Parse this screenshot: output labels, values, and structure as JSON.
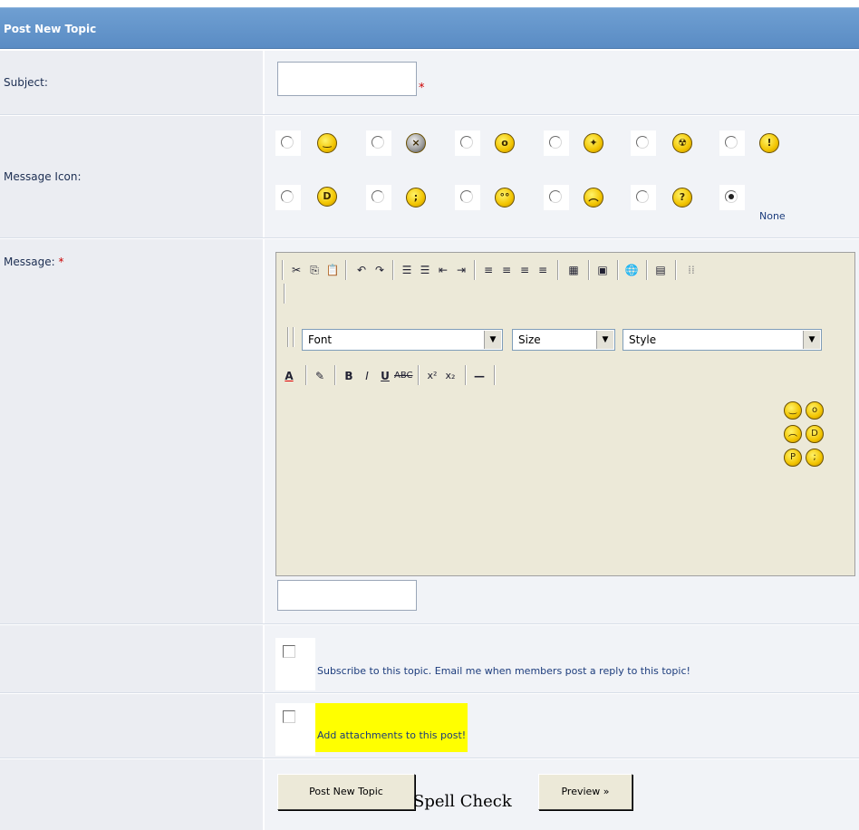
{
  "header": {
    "title": "Post New Topic"
  },
  "subject": {
    "label": "Subject:",
    "value": "",
    "required_mark": "*"
  },
  "message_icon": {
    "label": "Message Icon:",
    "none_label": "None",
    "selected": "None",
    "row1": [
      "smile-icon",
      "angry-icon",
      "shocked-icon",
      "star-icon",
      "radioactive-icon",
      "exclamation-icon"
    ],
    "row2": [
      "big-grin-icon",
      "wink-icon",
      "eyes-icon",
      "sad-icon",
      "question-icon"
    ]
  },
  "message": {
    "label": "Message:",
    "required_mark": "*"
  },
  "editor": {
    "font_select": "Font",
    "size_select": "Size",
    "style_select": "Style",
    "toolbar1": [
      "cut-icon",
      "copy-icon",
      "paste-icon",
      "undo-icon",
      "redo-icon",
      "ordered-list-icon",
      "unordered-list-icon",
      "outdent-icon",
      "indent-icon",
      "align-left-icon",
      "align-center-icon",
      "align-right-icon",
      "table-icon",
      "image-icon",
      "link-icon",
      "form-icon",
      "grid-icon"
    ],
    "toolbar3": [
      "font-color-icon",
      "highlight-icon",
      "bold-icon",
      "italic-icon",
      "underline-icon",
      "strikethrough-icon",
      "superscript-icon",
      "subscript-icon",
      "horizontal-rule-icon"
    ],
    "emoticons": [
      "smile-icon",
      "surprised-icon",
      "sad-icon",
      "laugh-icon",
      "tongue-icon",
      "wink-icon"
    ]
  },
  "subscribe": {
    "label": "Subscribe to this topic. Email me when members post a reply to this topic!",
    "checked": false
  },
  "attachments": {
    "label": "Add attachments to this post!",
    "checked": false,
    "highlight_color": "#ffff00"
  },
  "buttons": {
    "post": "Post New Topic",
    "spell": "Spell Check",
    "preview": "Preview »"
  }
}
